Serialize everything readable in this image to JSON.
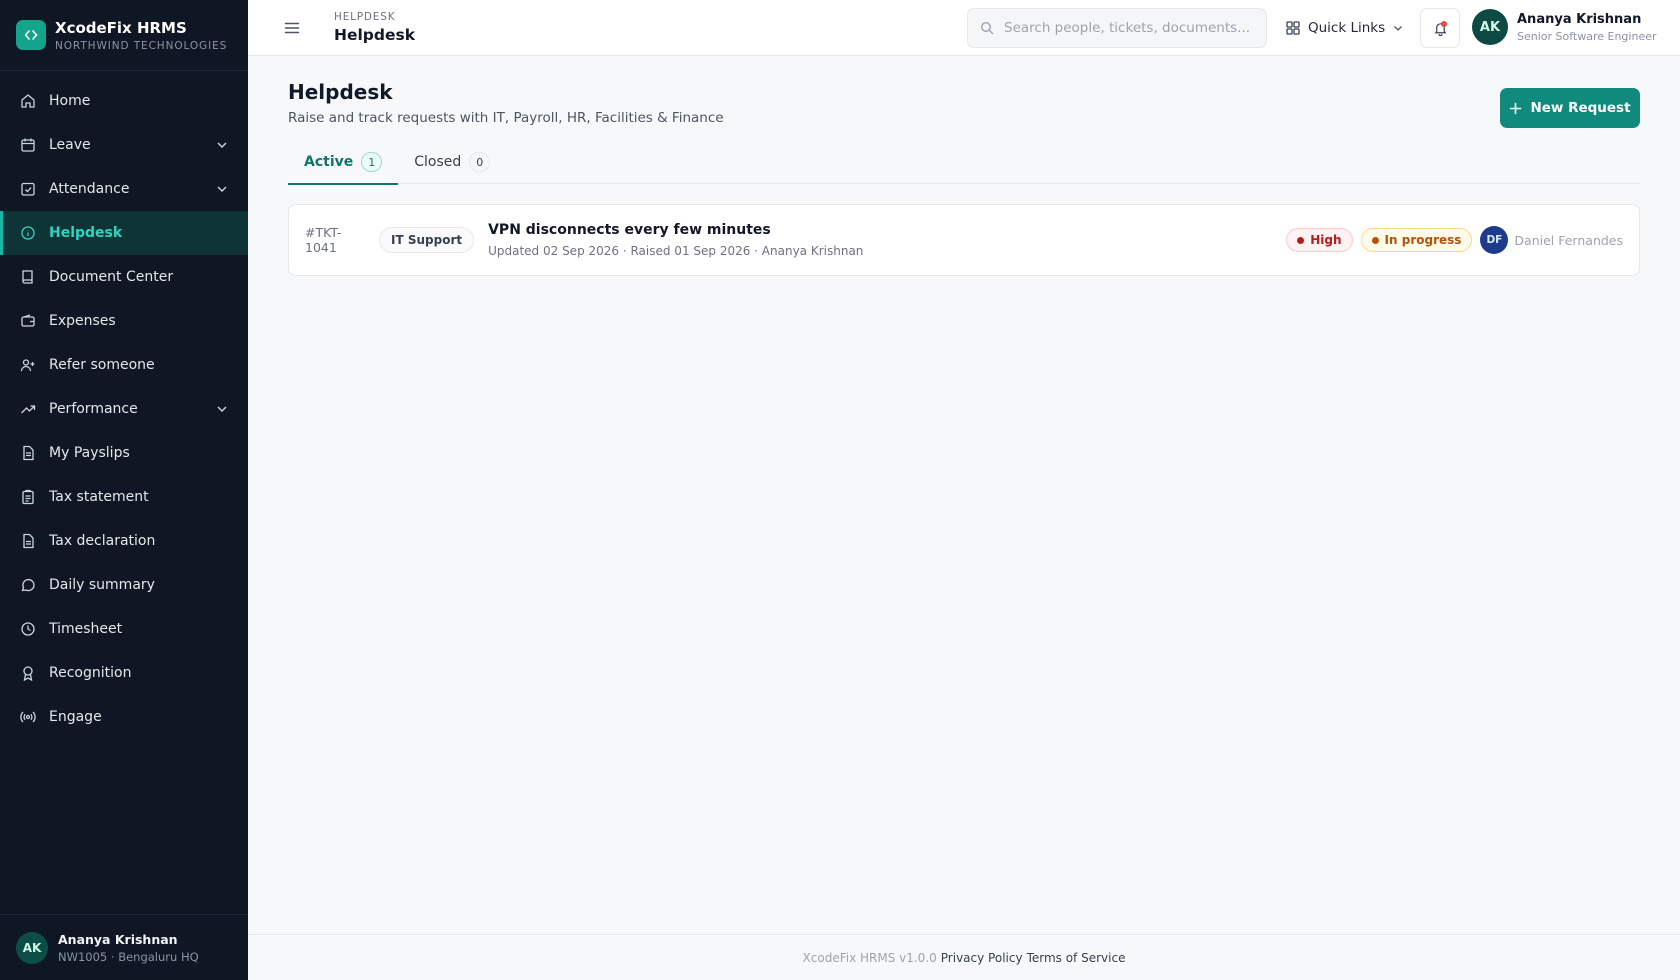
{
  "brand": {
    "name": "XcodeFix HRMS",
    "org": "NORTHWIND TECHNOLOGIES",
    "logo_icon": "code-brackets-icon",
    "color": "#14a38b"
  },
  "sidebar": {
    "items": [
      {
        "label": "Home",
        "icon": "home-icon"
      },
      {
        "label": "Leave",
        "icon": "calendar-icon",
        "expandable": true
      },
      {
        "label": "Attendance",
        "icon": "calendar-check-icon",
        "expandable": true
      },
      {
        "label": "Helpdesk",
        "icon": "info-circle-icon",
        "active": true
      },
      {
        "label": "Document Center",
        "icon": "book-icon"
      },
      {
        "label": "Expenses",
        "icon": "wallet-icon"
      },
      {
        "label": "Refer someone",
        "icon": "user-plus-icon"
      },
      {
        "label": "Performance",
        "icon": "trending-up-icon",
        "expandable": true
      },
      {
        "label": "My Payslips",
        "icon": "file-text-icon"
      },
      {
        "label": "Tax statement",
        "icon": "clipboard-icon"
      },
      {
        "label": "Tax declaration",
        "icon": "file-icon"
      },
      {
        "label": "Daily summary",
        "icon": "message-circle-icon"
      },
      {
        "label": "Timesheet",
        "icon": "clock-icon"
      },
      {
        "label": "Recognition",
        "icon": "award-icon"
      },
      {
        "label": "Engage",
        "icon": "broadcast-icon"
      }
    ],
    "footer": {
      "initials": "AK",
      "name": "Ananya Krishnan",
      "sub": "NW1005 · Bengaluru HQ"
    }
  },
  "topbar": {
    "crumb": "HELPDESK",
    "title": "Helpdesk",
    "search_placeholder": "Search people, tickets, documents...",
    "quick_links": "Quick Links",
    "user": {
      "initials": "AK",
      "name": "Ananya Krishnan",
      "role": "Senior Software Engineer"
    }
  },
  "page": {
    "title": "Helpdesk",
    "subtitle": "Raise and track requests with IT, Payroll, HR, Facilities & Finance",
    "new_button": "New Request",
    "tabs": [
      {
        "label": "Active",
        "count": "1",
        "active": true
      },
      {
        "label": "Closed",
        "count": "0",
        "active": false
      }
    ],
    "tickets": [
      {
        "id": "#TKT-1041",
        "category": "IT Support",
        "title": "VPN disconnects every few minutes",
        "meta": "Updated 02 Sep 2026 · Raised 01 Sep 2026 · Ananya Krishnan",
        "priority": "High",
        "status": "In progress",
        "assignee_initials": "DF",
        "assignee": "Daniel Fernandes"
      }
    ]
  },
  "footer": {
    "version": "XcodeFix HRMS v1.0.0",
    "privacy": "Privacy Policy",
    "terms": "Terms of Service"
  },
  "colors": {
    "accent": "#118a7e",
    "sidebar_bg": "#0f1724",
    "active_text": "#2dd4bf",
    "priority_high": "#b91c1c",
    "status_progress": "#b45309"
  }
}
